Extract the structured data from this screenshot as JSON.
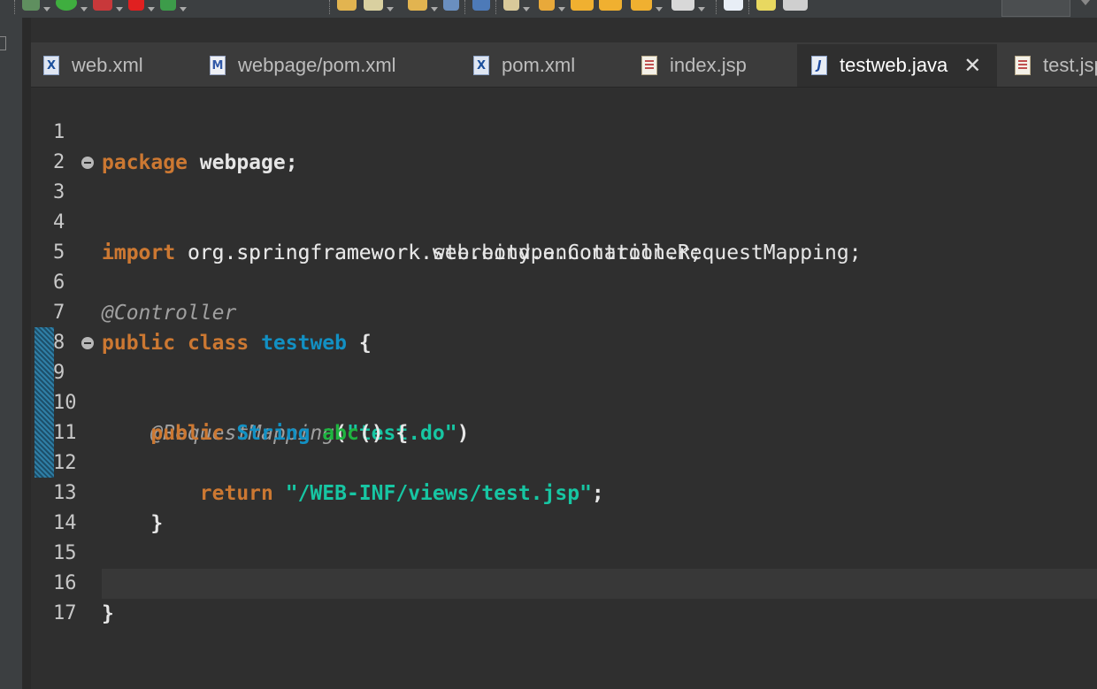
{
  "colors": {
    "keyword": "#cc7832",
    "annotation": "#a0a0a0",
    "string": "#17c6a3",
    "type": "#1290c3",
    "method": "#1eb540",
    "editor_background": "#2f2f2f"
  },
  "toolbar": {
    "icons": [
      "debug-icon",
      "run-icon",
      "external-tools-icon",
      "stop-icon",
      "run-last-icon",
      "open-folder-icon",
      "edit-icon",
      "open-file-icon",
      "globe-icon",
      "server-icon",
      "task-icon",
      "up-icon",
      "back-icon",
      "forward-icon",
      "previous-edit-icon",
      "next-icon",
      "new-window-icon",
      "highlight-icon",
      "perspective-icon"
    ]
  },
  "tabs": [
    {
      "label": "web.xml",
      "icon": "xml-file-icon",
      "icon_text": "X"
    },
    {
      "label": "webpage/pom.xml",
      "icon": "maven-pom-icon",
      "icon_text": "M"
    },
    {
      "label": "pom.xml",
      "icon": "xml-file-icon",
      "icon_text": "X"
    },
    {
      "label": "index.jsp",
      "icon": "jsp-file-icon",
      "icon_text": ""
    },
    {
      "label": "testweb.java",
      "icon": "java-file-icon",
      "icon_text": "J",
      "active": true
    },
    {
      "label": "test.jsp",
      "icon": "jsp-file-icon",
      "icon_text": ""
    }
  ],
  "close_glyph": "✕",
  "code": {
    "line_numbers": [
      "1",
      "2",
      "3",
      "4",
      "5",
      "6",
      "7",
      "8",
      "9",
      "10",
      "11",
      "12",
      "13",
      "14",
      "15",
      "16",
      "17"
    ],
    "l1": {
      "kw": "package",
      "rest": " webpage;"
    },
    "l3": {
      "kw": "import",
      "rest": " org.springframework.stereotype.Controller;"
    },
    "l4": {
      "kw": "import",
      "rest": " org.springframework.web.bind.annotation.RequestMapping;"
    },
    "l6": {
      "ann": "@Controller"
    },
    "l7": {
      "kw1": "public",
      "kw2": "class",
      "type": "testweb",
      "rest": " {"
    },
    "l9": {
      "indent": "    ",
      "ann": "@RequestMapping",
      "open": "(",
      "str": "\"test.do\"",
      "close": ")"
    },
    "l10": {
      "indent": "    ",
      "kw": "public",
      "type": "String",
      "meth": "abc",
      "rest": "() {"
    },
    "l12": {
      "indent": "        ",
      "kw": "return",
      "str": "\"/WEB-INF/views/test.jsp\"",
      "rest": ";"
    },
    "l13": {
      "text": "    }"
    },
    "l16": {
      "text": "}"
    }
  }
}
